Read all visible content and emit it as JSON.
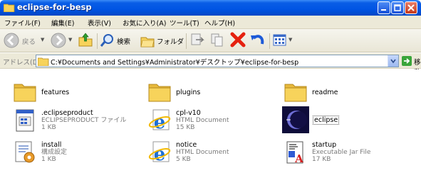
{
  "window": {
    "title": "eclipse-for-besp"
  },
  "menu": [
    "ファイル(F)",
    "編集(E)",
    "表示(V)",
    "お気に入り(A)",
    "ツール(T)",
    "ヘルプ(H)"
  ],
  "toolbar": {
    "back": "戻る",
    "search": "検索",
    "folders": "フォルダ"
  },
  "address": {
    "label": "アドレス(D)",
    "path": "C:¥Documents and Settings¥Administrator¥デスクトップ¥eclipse-for-besp",
    "go": "移動"
  },
  "files": [
    {
      "name": "features",
      "type": "",
      "size": "",
      "icon": "folder-icon"
    },
    {
      "name": "plugins",
      "type": "",
      "size": "",
      "icon": "folder-icon"
    },
    {
      "name": "readme",
      "type": "",
      "size": "",
      "icon": "folder-icon"
    },
    {
      "name": ".eclipseproduct",
      "type": "ECLIPSEPRODUCT ファイル",
      "size": "1 KB",
      "icon": "generic-file-icon"
    },
    {
      "name": "cpl-v10",
      "type": "HTML Document",
      "size": "15 KB",
      "icon": "ie-html-icon"
    },
    {
      "name": "eclipse",
      "type": "",
      "size": "",
      "icon": "eclipse-icon"
    },
    {
      "name": "install",
      "type": "構成設定",
      "size": "1 KB",
      "icon": "ini-settings-icon"
    },
    {
      "name": "notice",
      "type": "HTML Document",
      "size": "5 KB",
      "icon": "ie-html-icon"
    },
    {
      "name": "startup",
      "type": "Executable Jar File",
      "size": "17 KB",
      "icon": "jar-file-icon"
    }
  ],
  "colors": {
    "title_bar": "#0054e3",
    "chrome": "#ece9d8",
    "folder": "#f7d35b"
  }
}
